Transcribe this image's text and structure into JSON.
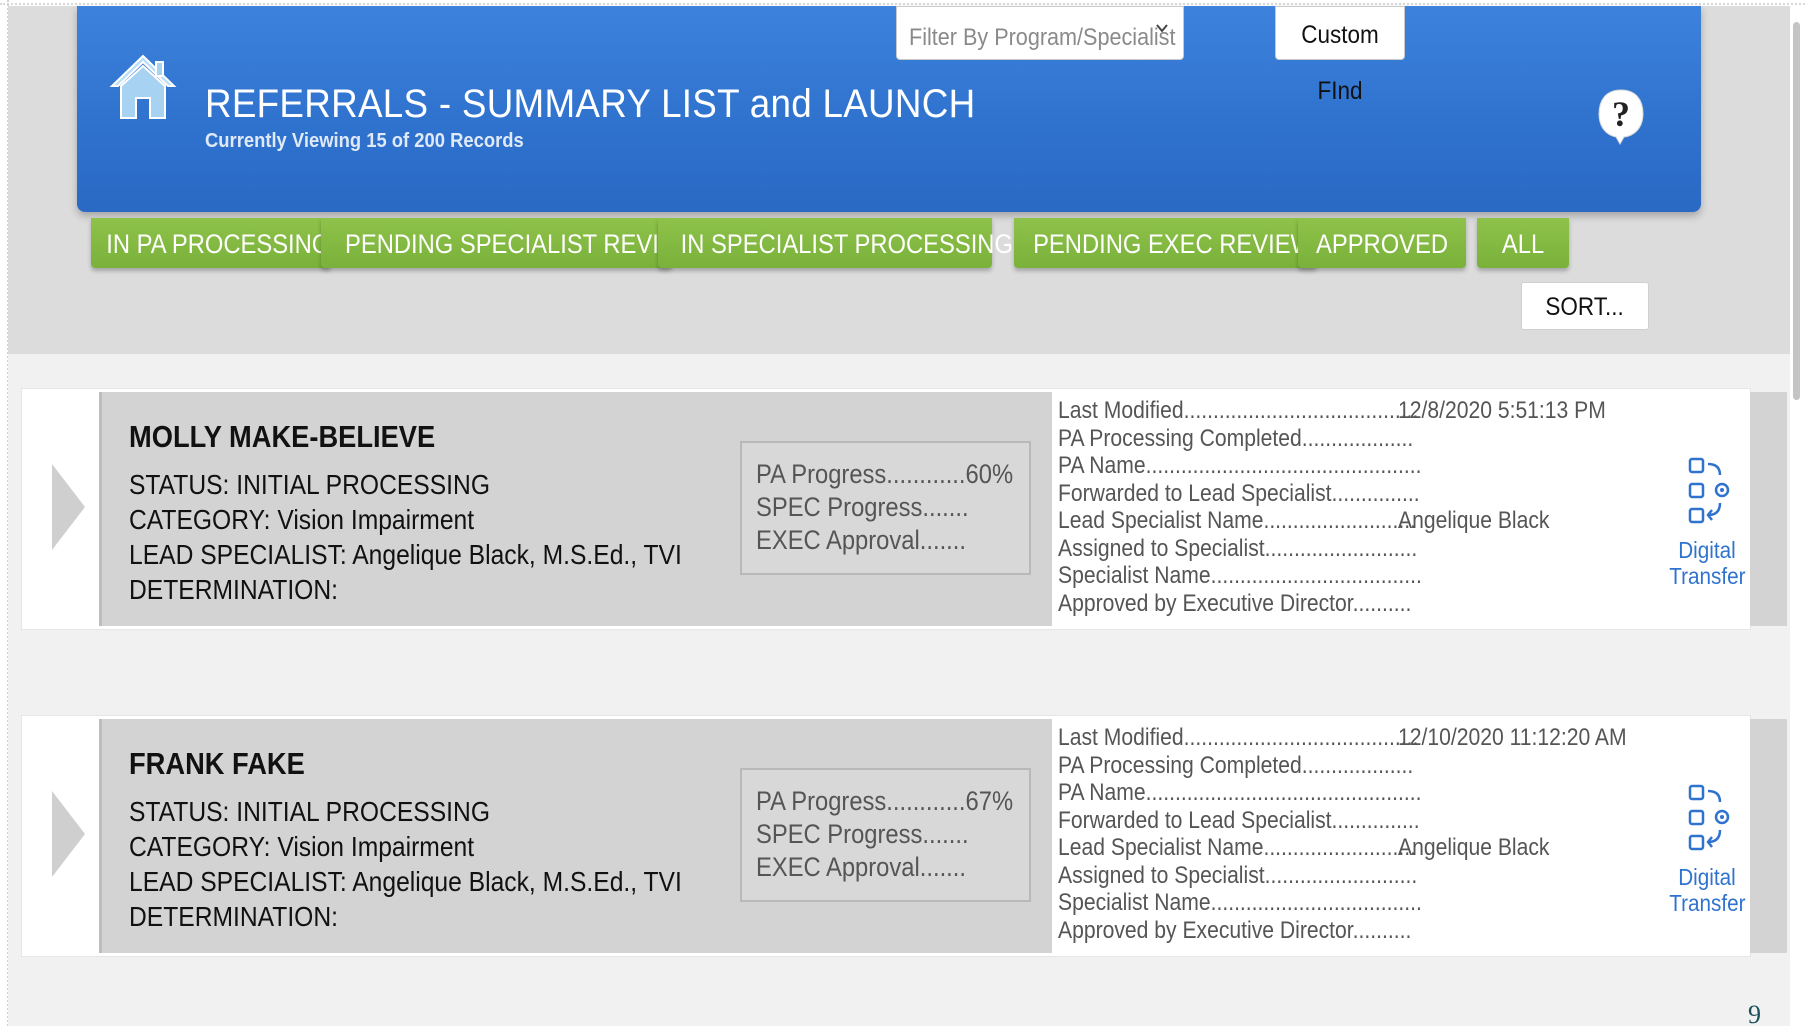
{
  "header": {
    "title": "REFERRALS - SUMMARY LIST and LAUNCH",
    "subtitle": "Currently Viewing 15 of 200 Records",
    "filter_placeholder": "Filter By Program/Specialist",
    "custom_find_label": "Custom FInd",
    "home_icon": "home-icon",
    "help_icon": "help-icon",
    "brand_color": "#2f73cf"
  },
  "status_tabs": [
    {
      "label": "IN PA PROCESSING"
    },
    {
      "label": "PENDING SPECIALIST REVIEW"
    },
    {
      "label": "IN SPECIALIST PROCESSING"
    },
    {
      "label": "PENDING EXEC REVIEW"
    },
    {
      "label": "APPROVED"
    },
    {
      "label": "ALL"
    }
  ],
  "tab_color": "#7fb640",
  "sort_label": "SORT...",
  "records": [
    {
      "name": "MOLLY MAKE-BELIEVE",
      "status": "STATUS: INITIAL PROCESSING",
      "category": "CATEGORY: Vision Impairment",
      "lead_specialist": "LEAD SPECIALIST: Angelique Black, M.S.Ed., TVI",
      "determination": "DETERMINATION:",
      "pa_progress": "PA Progress............60%",
      "spec_progress": "SPEC Progress.......",
      "exec_approval": "EXEC Approval.......",
      "meta": [
        {
          "label": "Last Modified........................................",
          "value": "12/8/2020 5:51:13 PM"
        },
        {
          "label": "PA Processing Completed...................",
          "value": ""
        },
        {
          "label": "PA Name...............................................",
          "value": ""
        },
        {
          "label": "Forwarded to Lead Specialist...............",
          "value": ""
        },
        {
          "label": "Lead Specialist Name..........................",
          "value": "Angelique Black"
        },
        {
          "label": "Assigned to Specialist..........................",
          "value": ""
        },
        {
          "label": "Specialist Name....................................",
          "value": ""
        },
        {
          "label": "Approved by Executive Director..........",
          "value": ""
        }
      ],
      "transfer_label_1": "Digital",
      "transfer_label_2": "Transfer"
    },
    {
      "name": "FRANK FAKE",
      "status": "STATUS: INITIAL PROCESSING",
      "category": "CATEGORY: Vision Impairment",
      "lead_specialist": "LEAD SPECIALIST: Angelique Black, M.S.Ed., TVI",
      "determination": "DETERMINATION:",
      "pa_progress": "PA Progress............67%",
      "spec_progress": "SPEC Progress.......",
      "exec_approval": "EXEC Approval.......",
      "meta": [
        {
          "label": "Last Modified........................................",
          "value": "12/10/2020 11:12:20 AM"
        },
        {
          "label": "PA Processing Completed...................",
          "value": ""
        },
        {
          "label": "PA Name...............................................",
          "value": ""
        },
        {
          "label": "Forwarded to Lead Specialist...............",
          "value": ""
        },
        {
          "label": "Lead Specialist Name..........................",
          "value": "Angelique Black"
        },
        {
          "label": "Assigned to Specialist..........................",
          "value": ""
        },
        {
          "label": "Specialist Name....................................",
          "value": ""
        },
        {
          "label": "Approved by Executive Director..........",
          "value": ""
        }
      ],
      "transfer_label_1": "Digital",
      "transfer_label_2": "Transfer"
    }
  ],
  "page_number": "9"
}
